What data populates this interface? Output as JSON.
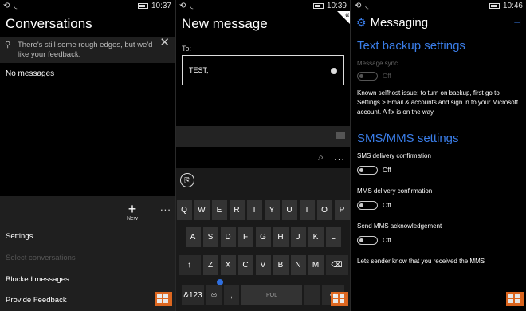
{
  "panel1": {
    "status_time": "10:37",
    "title": "Conversations",
    "info_text": "There's still some rough edges, but we'd like your feedback.",
    "empty_text": "No messages",
    "new_label": "New",
    "more": "...",
    "menu": {
      "settings": "Settings",
      "select": "Select conversations",
      "blocked": "Blocked messages",
      "feedback": "Provide Feedback"
    }
  },
  "panel2": {
    "status_time": "10:39",
    "title": "New message",
    "to_label": "To:",
    "to_value": "TEST,",
    "more": "...",
    "keys_row1": [
      "Q",
      "W",
      "E",
      "R",
      "T",
      "Y",
      "U",
      "I",
      "O",
      "P"
    ],
    "keys_row2": [
      "A",
      "S",
      "D",
      "F",
      "G",
      "H",
      "J",
      "K",
      "L"
    ],
    "keys_row3": [
      "Z",
      "X",
      "C",
      "V",
      "B",
      "N",
      "M"
    ],
    "key_123": "&123",
    "key_lang": "POL"
  },
  "panel3": {
    "status_time": "10:46",
    "title": "Messaging",
    "text_backup_heading": "Text backup settings",
    "message_sync_label": "Message sync",
    "off": "Off",
    "known_issue": "Known selfhost issue: to turn on backup, first go to Settings > Email & accounts and sign in to your Microsoft account. A fix is on the way.",
    "sms_heading": "SMS/MMS settings",
    "sms_delivery": "SMS delivery confirmation",
    "mms_delivery": "MMS delivery confirmation",
    "mms_ack": "Send MMS acknowledgement",
    "mms_ack_desc": "Lets sender know that you received the MMS"
  }
}
